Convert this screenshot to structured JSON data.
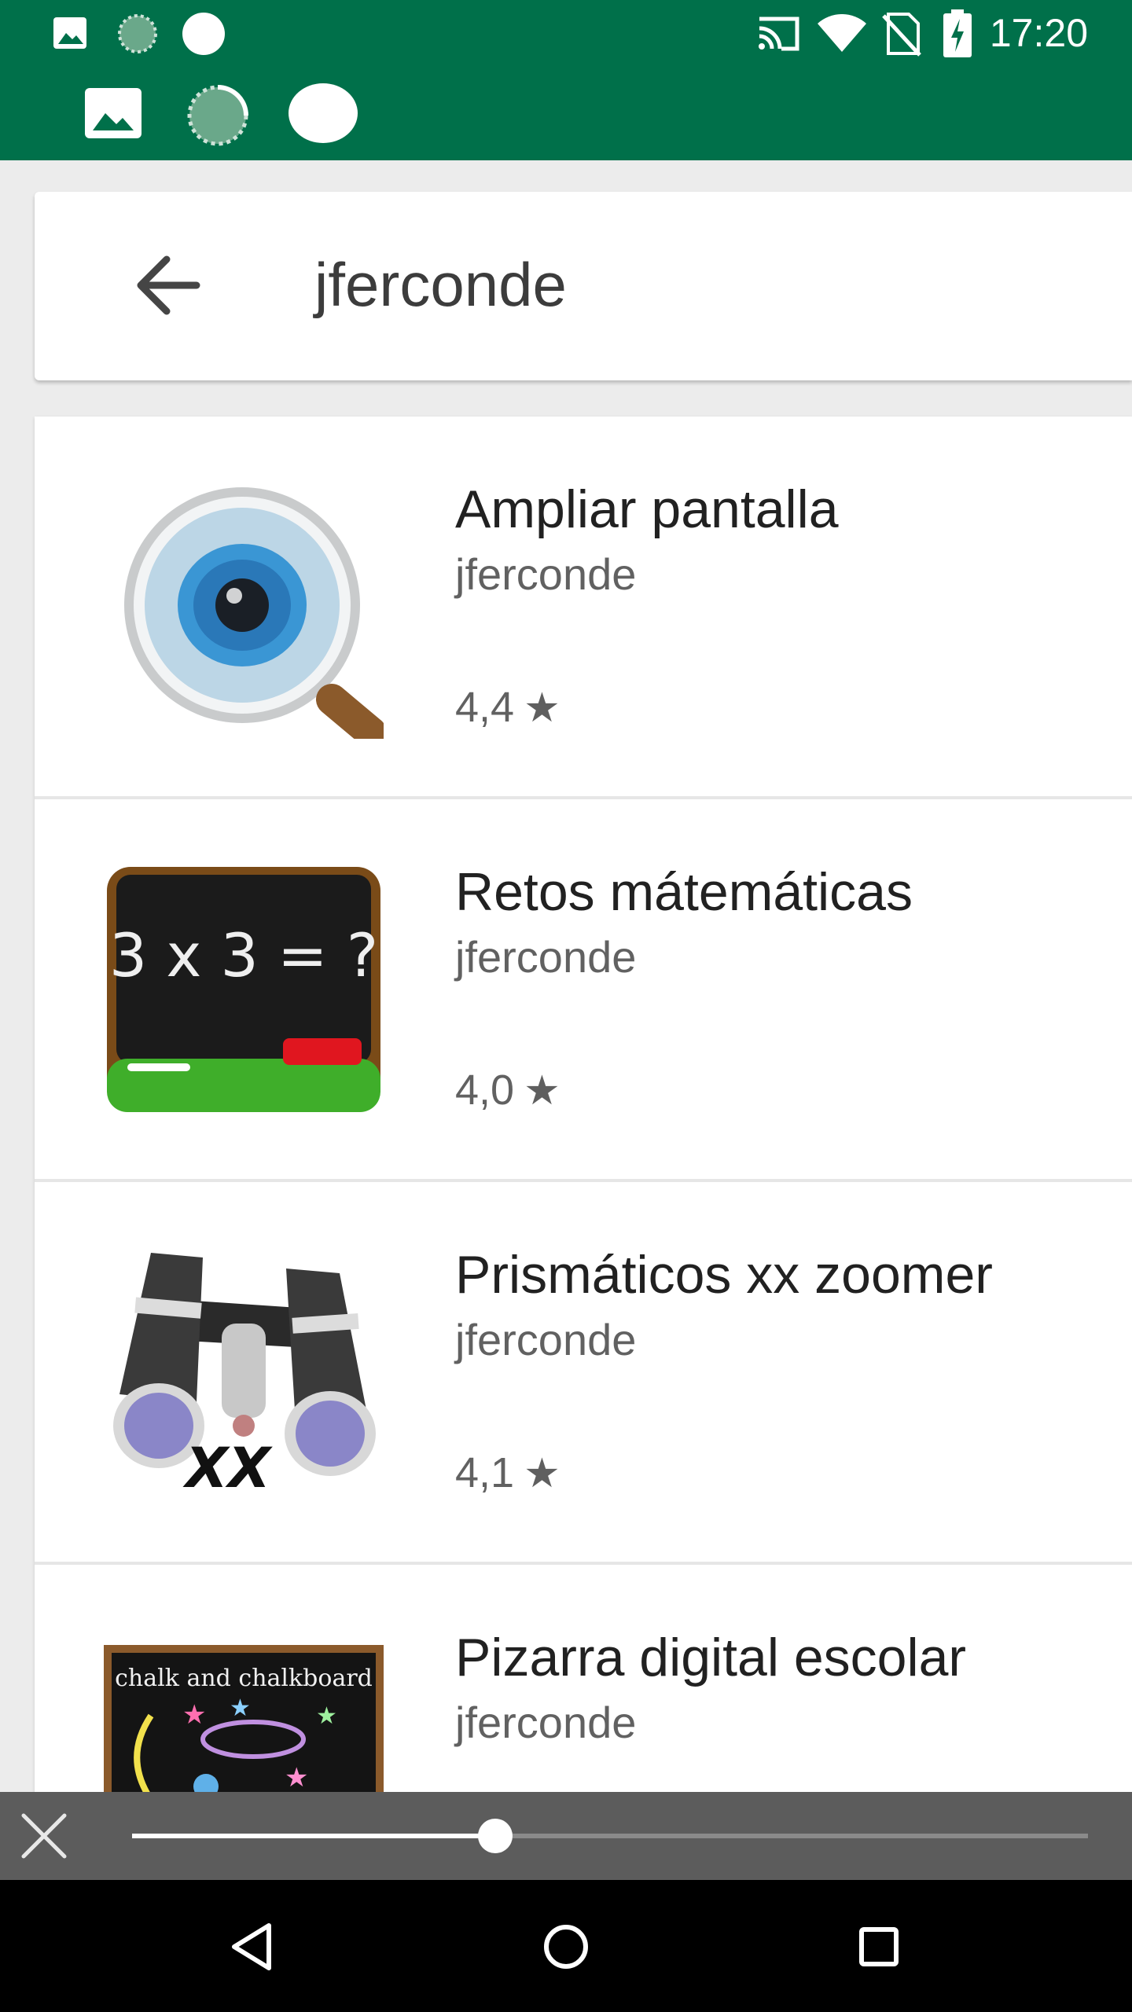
{
  "status_bar": {
    "time": "17:20",
    "icons": [
      "image-icon",
      "loading-icon",
      "circle-icon",
      "cast-icon",
      "wifi-icon",
      "no-sim-icon",
      "battery-charging-icon"
    ],
    "row2_icons": [
      "image-icon",
      "loading-icon",
      "circle-icon"
    ],
    "background": "#00704a"
  },
  "search": {
    "query": "jferconde",
    "back_icon": "arrow-left-icon"
  },
  "results": [
    {
      "title": "Ampliar pantalla",
      "developer": "jferconde",
      "rating": "4,4",
      "icon": "magnifier-eye-icon"
    },
    {
      "title": "Retos mátemáticas",
      "developer": "jferconde",
      "rating": "4,0",
      "icon": "chalkboard-math-icon",
      "icon_text": "3 x 3 = ?"
    },
    {
      "title": "Prismáticos xx zoomer",
      "developer": "jferconde",
      "rating": "4,1",
      "icon": "binoculars-icon",
      "icon_text": "XX"
    },
    {
      "title": "Pizarra digital escolar",
      "developer": "jferconde",
      "rating": "",
      "icon": "chalkboard-drawing-icon",
      "icon_text": "chalk and chalkboard"
    }
  ],
  "media_control": {
    "progress": 0.38,
    "close_icon": "close-icon"
  },
  "nav_bar": {
    "icons": [
      "back-triangle-icon",
      "home-circle-icon",
      "recents-square-icon"
    ]
  }
}
